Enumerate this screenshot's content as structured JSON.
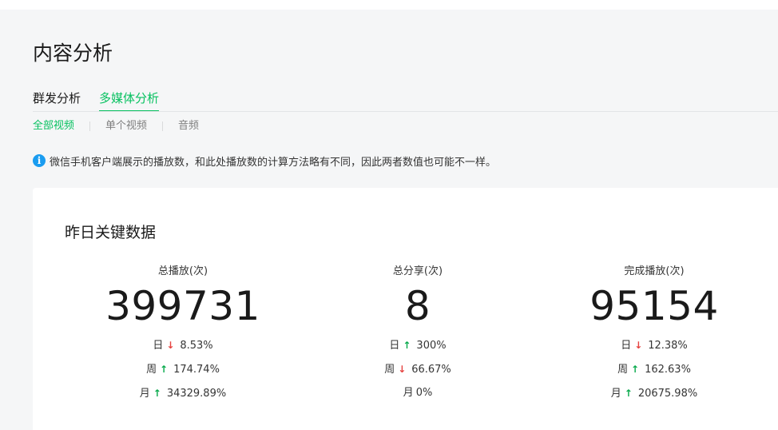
{
  "page": {
    "title": "内容分析"
  },
  "main_tabs": [
    {
      "label": "群发分析",
      "active": false
    },
    {
      "label": "多媒体分析",
      "active": true
    }
  ],
  "sub_tabs": [
    {
      "label": "全部视频",
      "active": true
    },
    {
      "label": "单个视频",
      "active": false
    },
    {
      "label": "音频",
      "active": false
    }
  ],
  "notice": {
    "icon": "info-icon",
    "text": "微信手机客户端展示的播放数，和此处播放数的计算方法略有不同，因此两者数值也可能不一样。"
  },
  "key_data": {
    "title": "昨日关键数据",
    "metrics": [
      {
        "label": "总播放(次)",
        "value": "399731",
        "trends": [
          {
            "label": "日",
            "direction": "down",
            "value": "8.53%"
          },
          {
            "label": "周",
            "direction": "up",
            "value": "174.74%"
          },
          {
            "label": "月",
            "direction": "up",
            "value": "34329.89%"
          }
        ]
      },
      {
        "label": "总分享(次)",
        "value": "8",
        "trends": [
          {
            "label": "日",
            "direction": "up",
            "value": "300%"
          },
          {
            "label": "周",
            "direction": "down",
            "value": "66.67%"
          },
          {
            "label": "月",
            "direction": "none",
            "value": "0%"
          }
        ]
      },
      {
        "label": "完成播放(次)",
        "value": "95154",
        "trends": [
          {
            "label": "日",
            "direction": "down",
            "value": "12.38%"
          },
          {
            "label": "周",
            "direction": "up",
            "value": "162.63%"
          },
          {
            "label": "月",
            "direction": "up",
            "value": "20675.98%"
          }
        ]
      }
    ]
  },
  "colors": {
    "accent": "#07c160",
    "up": "#07a94b",
    "down": "#e64340",
    "info": "#1a9cf0"
  }
}
